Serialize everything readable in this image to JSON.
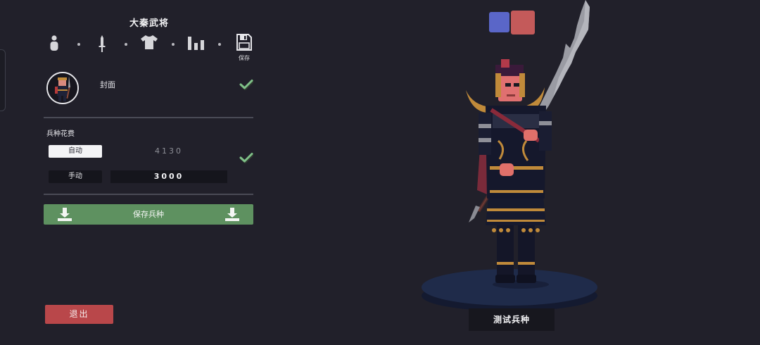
{
  "panel": {
    "title": "大秦武将",
    "tabs": [
      {
        "icon": "unit-icon"
      },
      {
        "icon": "weapon-icon"
      },
      {
        "icon": "armor-icon"
      },
      {
        "icon": "stats-icon"
      },
      {
        "icon": "save-icon",
        "label": "保存"
      }
    ]
  },
  "cover": {
    "label": "封面",
    "checked": true
  },
  "cost": {
    "label": "兵种花费",
    "auto_label": "自动",
    "auto_value": "4130",
    "manual_label": "手动",
    "manual_value": "3000",
    "selected_mode": "自动"
  },
  "buttons": {
    "save_unit": "保存兵种",
    "exit": "退出",
    "test_unit": "测试兵种"
  },
  "team_colors": [
    "#5a66c8",
    "#c45a5a"
  ],
  "colors": {
    "save_green": "#5e9160",
    "exit_red": "#b9474a",
    "background": "#21202a"
  }
}
